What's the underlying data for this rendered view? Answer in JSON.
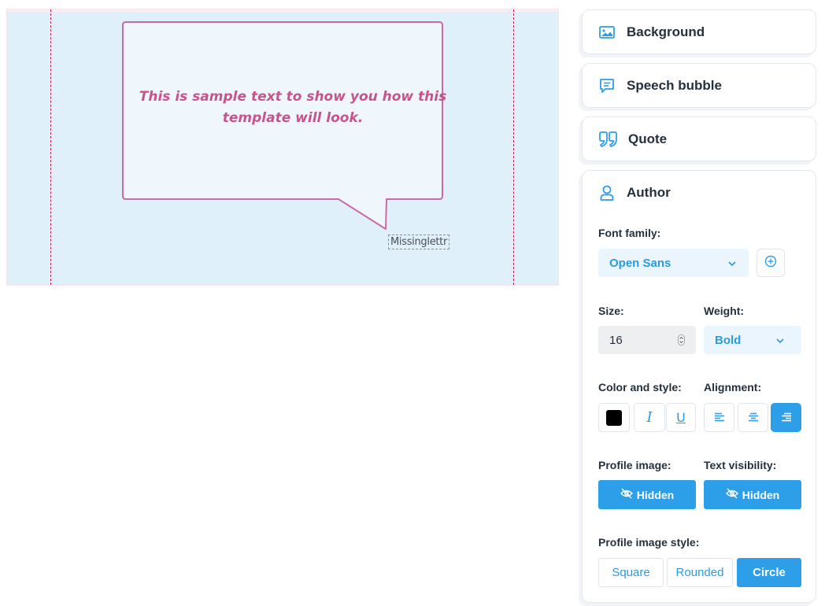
{
  "canvas": {
    "quote_text": "This is sample text to show you how this template will look.",
    "author_text": "Missinglettr",
    "background_color": "#dff0fa",
    "bubble_stroke_color": "#cc6aa3",
    "text_color": "#c7538f"
  },
  "panel": {
    "sections": [
      {
        "label": "Background",
        "icon": "image-icon"
      },
      {
        "label": "Speech bubble",
        "icon": "speech-bubble-icon"
      },
      {
        "label": "Quote",
        "icon": "quote-icon"
      },
      {
        "label": "Author",
        "icon": "user-icon"
      }
    ],
    "author": {
      "font_family_label": "Font family:",
      "font_family_value": "Open Sans",
      "size_label": "Size:",
      "size_value": "16",
      "weight_label": "Weight:",
      "weight_value": "Bold",
      "color_style_label": "Color and style:",
      "color_value": "#000000",
      "alignment_label": "Alignment:",
      "alignment_selected": "right",
      "profile_image_label": "Profile image:",
      "profile_image_value": "Hidden",
      "text_visibility_label": "Text visibility:",
      "text_visibility_value": "Hidden",
      "profile_style_label": "Profile image style:",
      "profile_styles": [
        "Square",
        "Rounded",
        "Circle"
      ],
      "profile_style_selected": "Circle"
    },
    "accent_color": "#2d9fe8"
  }
}
